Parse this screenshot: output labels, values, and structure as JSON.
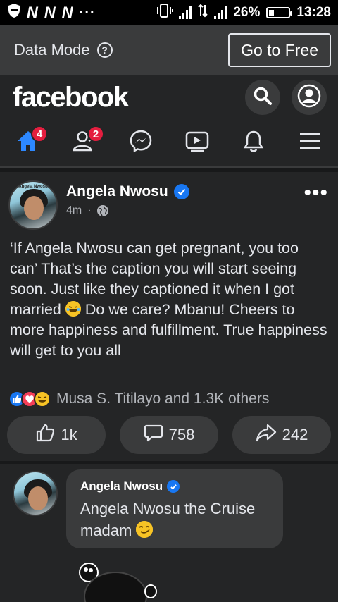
{
  "status_bar": {
    "network_glyphs": [
      "N",
      "N",
      "N"
    ],
    "more": "···",
    "battery": "26%",
    "time": "13:28"
  },
  "data_mode": {
    "label": "Data Mode",
    "cta": "Go to Free"
  },
  "header": {
    "logo": "facebook"
  },
  "nav": {
    "home_badge": "4",
    "friends_badge": "2"
  },
  "post": {
    "author": "Angela Nwosu",
    "time": "4m",
    "separator": "·",
    "avatar_text": "Angela Nwosu",
    "text": "‘If Angela Nwosu can get pregnant, you too can’ That’s the caption you will start seeing soon. Just like they captioned it when I got married",
    "text_after": " Do we care? Mbanu! Cheers to more happiness and fulfillment. True happiness will get to you all",
    "reactions_summary": "Musa S. Titilayo and 1.3K others",
    "like_count": "1k",
    "comment_count": "758",
    "share_count": "242"
  },
  "comment": {
    "author": "Angela Nwosu",
    "text": "Angela Nwosu the Cruise madam"
  },
  "colors": {
    "accent": "#1877f2",
    "badge": "#e41e3f",
    "background": "#242526"
  }
}
